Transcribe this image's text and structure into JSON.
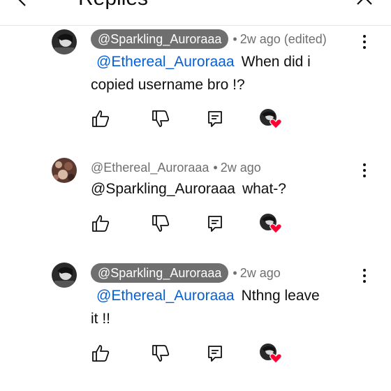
{
  "header": {
    "title": "Replies"
  },
  "comments": [
    {
      "author": "@Sparkling_Auroraaa",
      "author_pill": true,
      "separator": "•",
      "time": "2w ago (edited)",
      "mention": "@Ethereal_Auroraaa",
      "text_line1": "When did i",
      "text_line2": "copied username bro !?"
    },
    {
      "author": "@Ethereal_Auroraaa",
      "author_pill": false,
      "separator": "•",
      "time": "2w ago",
      "mention": "@Sparkling_Auroraaa",
      "text_line1": "what-?",
      "text_line2": ""
    },
    {
      "author": "@Sparkling_Auroraaa",
      "author_pill": true,
      "separator": "•",
      "time": "2w ago",
      "mention": "@Ethereal_Auroraaa",
      "text_line1": "Nthng leave",
      "text_line2": "it !!"
    }
  ],
  "icons": {
    "like": "thumbs-up-icon",
    "dislike": "thumbs-down-icon",
    "reply": "reply-icon",
    "more": "more-vertical-icon",
    "creator_heart": "creator-heart-icon"
  },
  "colors": {
    "mention": "#065fd4",
    "pill_bg": "#6f6f6f",
    "meta_text": "#6f6f6f",
    "heart": "#ff0033"
  }
}
